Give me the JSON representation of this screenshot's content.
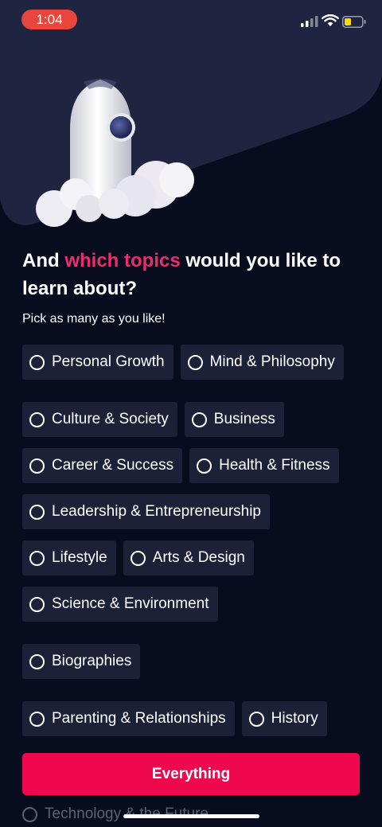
{
  "status_bar": {
    "time": "1:04",
    "time_pill_color": "#e8453c",
    "icons": [
      "cellular-signal-icon",
      "wifi-icon",
      "battery-low-icon"
    ]
  },
  "hero": {
    "illustration": "rocket-launch-illustration"
  },
  "heading": {
    "before": "And ",
    "highlight": "which topics",
    "after": " would you like to learn about?",
    "highlight_color": "#ec2d6b"
  },
  "subheading": "Pick as many as you like!",
  "topics": [
    {
      "label": "Personal Growth",
      "selected": false
    },
    {
      "label": "Mind & Philosophy",
      "selected": false
    },
    {
      "label": "Culture & Society",
      "selected": false
    },
    {
      "label": "Business",
      "selected": false
    },
    {
      "label": "Career & Success",
      "selected": false
    },
    {
      "label": "Health & Fitness",
      "selected": false
    },
    {
      "label": "Leadership & Entrepreneurship",
      "selected": false
    },
    {
      "label": "Lifestyle",
      "selected": false
    },
    {
      "label": "Arts & Design",
      "selected": false
    },
    {
      "label": "Science & Environment",
      "selected": false
    },
    {
      "label": "Biographies",
      "selected": false
    },
    {
      "label": "Parenting & Relationships",
      "selected": false
    },
    {
      "label": "History",
      "selected": false
    }
  ],
  "partially_visible_topic": {
    "label": "Technology & the Future"
  },
  "cta": {
    "label": "Everything",
    "color": "#f0084f"
  },
  "colors": {
    "background": "#080c1f",
    "hero_panel": "#1f2540",
    "chip": "#1c2138"
  }
}
